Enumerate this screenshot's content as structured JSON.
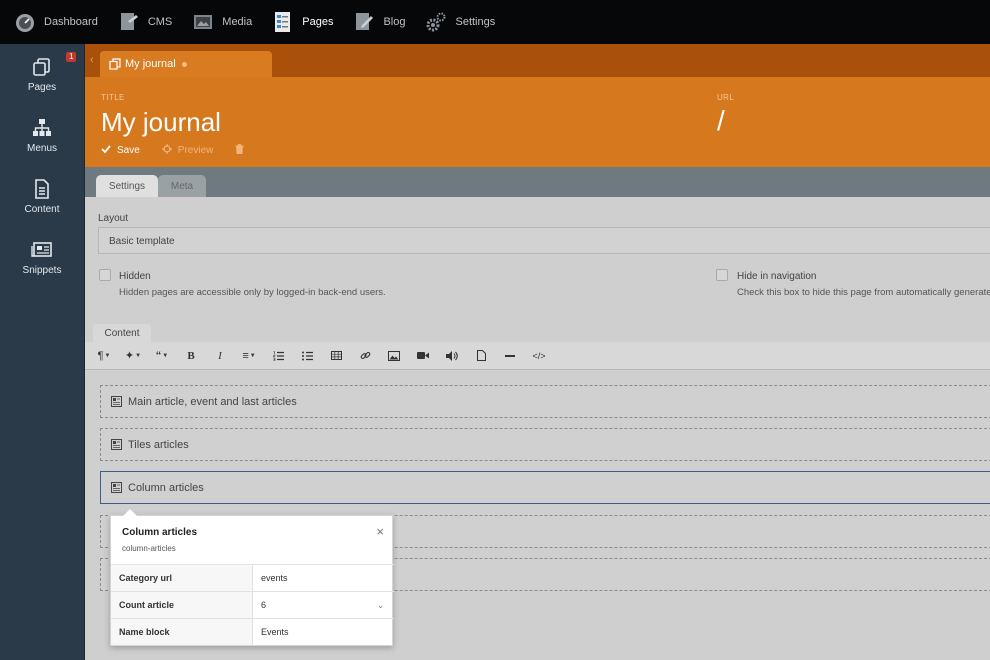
{
  "topnav": [
    {
      "label": "Dashboard",
      "icon": "dashboard-icon"
    },
    {
      "label": "CMS",
      "icon": "cms-icon"
    },
    {
      "label": "Media",
      "icon": "media-icon"
    },
    {
      "label": "Pages",
      "icon": "pages-icon",
      "active": true
    },
    {
      "label": "Blog",
      "icon": "blog-icon"
    },
    {
      "label": "Settings",
      "icon": "gear-icon"
    }
  ],
  "sidebar": {
    "badge": "1",
    "items": [
      {
        "label": "Pages",
        "icon": "pages-icon"
      },
      {
        "label": "Menus",
        "icon": "sitemap-icon"
      },
      {
        "label": "Content",
        "icon": "document-icon"
      },
      {
        "label": "Snippets",
        "icon": "newspaper-icon"
      }
    ]
  },
  "doc_tab": {
    "label": "My journal"
  },
  "header": {
    "title_label": "TITLE",
    "title": "My journal",
    "url_label": "URL",
    "url": "/",
    "save": "Save",
    "preview": "Preview"
  },
  "tabs": {
    "settings": "Settings",
    "meta": "Meta"
  },
  "form": {
    "layout_label": "Layout",
    "layout_value": "Basic template",
    "hidden_label": "Hidden",
    "hidden_hint": "Hidden pages are accessible only by logged-in back-end users.",
    "hide_nav_label": "Hide in navigation",
    "hide_nav_hint": "Check this box to hide this page from automatically generated",
    "content_tab": "Content"
  },
  "blocks": [
    {
      "label": "Main article, event and last articles"
    },
    {
      "label": "Tiles articles"
    },
    {
      "label": "Column articles"
    },
    {
      "label": ""
    },
    {
      "label": ""
    }
  ],
  "popup": {
    "title": "Column articles",
    "subtitle": "column-articles",
    "rows": [
      {
        "key": "Category url",
        "value": "events"
      },
      {
        "key": "Count article",
        "value": "6"
      },
      {
        "key": "Name block",
        "value": "Events"
      }
    ]
  },
  "colors": {
    "orange": "#d6791e",
    "dark_orange": "#a9510a",
    "nav": "#060709",
    "sidebar": "#2b3a48"
  }
}
